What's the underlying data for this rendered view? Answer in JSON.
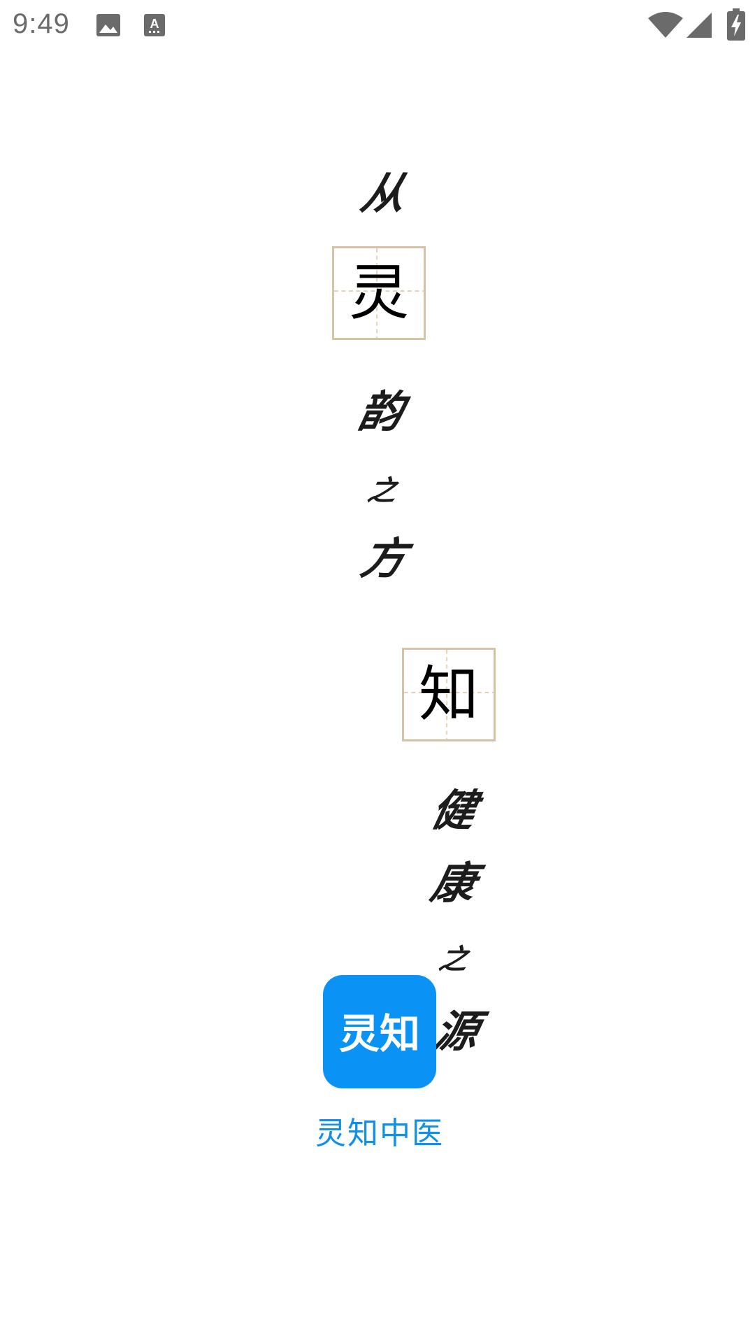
{
  "status_bar": {
    "time": "9:49",
    "icons": [
      "image-icon",
      "keyboard-icon",
      "wifi-icon",
      "signal-icon",
      "battery-charging-icon"
    ]
  },
  "slogan": {
    "column1": {
      "c1": "从",
      "boxed": "灵",
      "c3": "韵",
      "c4": "之",
      "c5": "方"
    },
    "column2": {
      "boxed": "知",
      "c2": "健",
      "c3": "康",
      "c4": "之",
      "c5": "源"
    }
  },
  "app": {
    "name": "灵知中医",
    "logo_text": "灵知",
    "brand_color": "#0a93f5"
  },
  "colors": {
    "grid_border": "#d6c3a6",
    "grid_guides": "#e3cfb4",
    "app_name": "#1190e8"
  }
}
